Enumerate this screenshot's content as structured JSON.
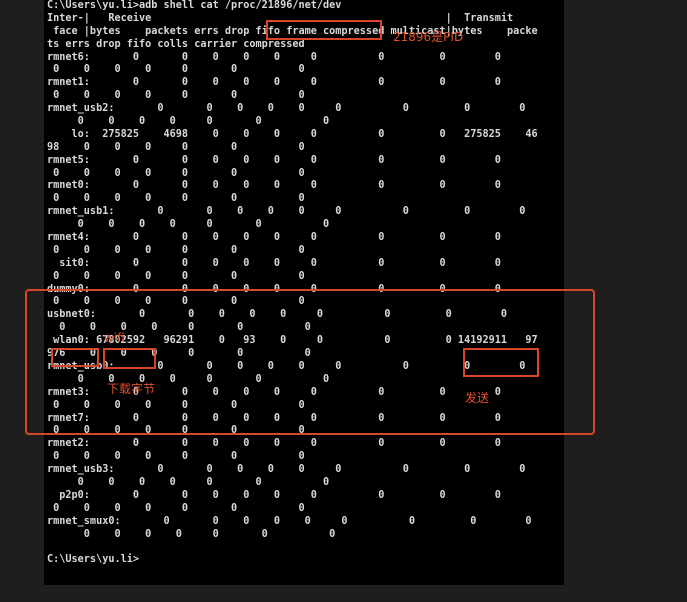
{
  "console": {
    "lines": [
      "C:\\Users\\yu.li>adb shell cat /proc/21896/net/dev",
      "Inter-|   Receive                                                |  Transmit",
      " face |bytes    packets errs drop fifo frame compressed multicast|bytes    packe",
      "ts errs drop fifo colls carrier compressed",
      "rmnet6:       0       0    0    0    0     0          0         0        0",
      " 0    0    0    0     0       0          0",
      "rmnet1:       0       0    0    0    0     0          0         0        0",
      " 0    0    0    0     0       0          0",
      "rmnet_usb2:       0       0    0    0    0     0          0         0        0",
      "     0    0    0    0     0       0          0",
      "    lo:  275825    4698    0    0    0     0          0         0   275825    46",
      "98    0    0    0     0       0          0",
      "rmnet5:       0       0    0    0    0     0          0         0        0",
      " 0    0    0    0     0       0          0",
      "rmnet0:       0       0    0    0    0     0          0         0        0",
      " 0    0    0    0     0       0          0",
      "rmnet_usb1:       0       0    0    0    0     0          0         0        0",
      "     0    0    0    0     0       0          0",
      "rmnet4:       0       0    0    0    0     0          0         0        0",
      " 0    0    0    0     0       0          0",
      "  sit0:       0       0    0    0    0     0          0         0        0",
      " 0    0    0    0     0       0          0",
      "dummy0:       0       0    0    0    0     0          0         0        0",
      " 0    0    0    0     0       0          0",
      "usbnet0:       0       0    0    0    0     0          0         0        0",
      "  0    0    0    0     0       0          0",
      " wlan0: 67802592   96291    0   93    0     0          0         0 14192911   97",
      "976    0    0    0     0       0          0",
      "rmnet_usb0:       0       0    0    0    0     0          0         0        0",
      "     0    0    0    0     0       0          0",
      "rmnet3:       0       0    0    0    0     0          0         0        0",
      " 0    0    0    0     0       0          0",
      "rmnet7:       0       0    0    0    0     0          0         0        0",
      " 0    0    0    0     0       0          0",
      "rmnet2:       0       0    0    0    0     0          0         0        0",
      " 0    0    0    0     0       0          0",
      "rmnet_usb3:       0       0    0    0    0     0          0         0        0",
      "     0    0    0    0     0       0          0",
      "  p2p0:       0       0    0    0    0     0          0         0        0",
      " 0    0    0    0     0       0          0",
      "rmnet_smux0:       0       0    0    0    0     0          0         0        0",
      "      0    0    0    0     0       0          0",
      "",
      "C:\\Users\\yu.li>"
    ]
  },
  "annotations": {
    "pid_label": "21896是PID",
    "wifi_label": "wifi",
    "download_label": "下载字节",
    "send_label": "发送"
  },
  "colors": {
    "accent": "#d9472b",
    "console_bg": "#000000",
    "console_text": "#d9d9d9"
  }
}
